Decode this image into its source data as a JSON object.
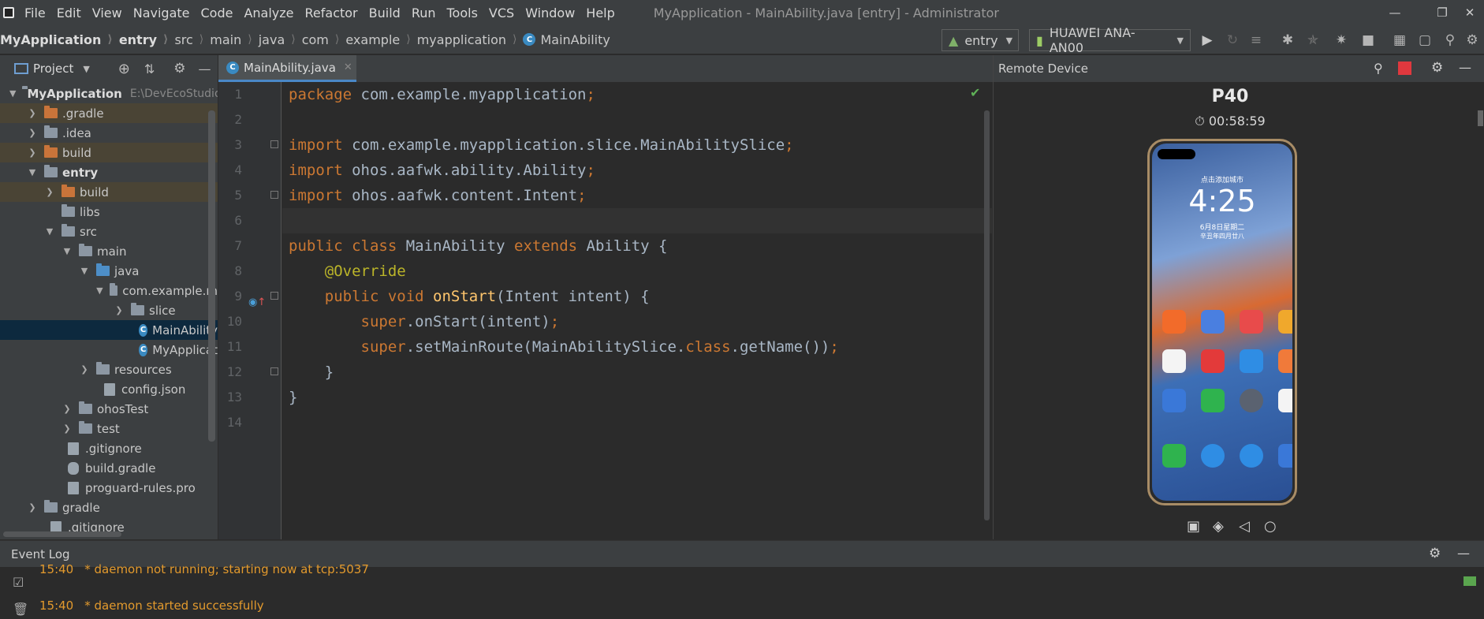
{
  "menubar": {
    "items": [
      "File",
      "Edit",
      "View",
      "Navigate",
      "Code",
      "Analyze",
      "Refactor",
      "Build",
      "Run",
      "Tools",
      "VCS",
      "Window",
      "Help"
    ],
    "title": "MyApplication - MainAbility.java [entry] - Administrator"
  },
  "breadcrumb": [
    "MyApplication",
    "entry",
    "src",
    "main",
    "java",
    "com",
    "example",
    "myapplication",
    "MainAbility"
  ],
  "toolbar": {
    "module": "entry",
    "device": "HUAWEI ANA-AN00"
  },
  "project": {
    "title": "Project",
    "tree": [
      {
        "label": "MyApplication",
        "extra": "E:\\DevEcoStudio"
      },
      {
        "label": ".gradle"
      },
      {
        "label": ".idea"
      },
      {
        "label": "build"
      },
      {
        "label": "entry"
      },
      {
        "label": "build"
      },
      {
        "label": "libs"
      },
      {
        "label": "src"
      },
      {
        "label": "main"
      },
      {
        "label": "java"
      },
      {
        "label": "com.example.m"
      },
      {
        "label": "slice"
      },
      {
        "label": "MainAbility"
      },
      {
        "label": "MyApplicat"
      },
      {
        "label": "resources"
      },
      {
        "label": "config.json"
      },
      {
        "label": "ohosTest"
      },
      {
        "label": "test"
      },
      {
        "label": ".gitignore"
      },
      {
        "label": "build.gradle"
      },
      {
        "label": "proguard-rules.pro"
      },
      {
        "label": "gradle"
      },
      {
        "label": ".gitignore"
      }
    ]
  },
  "editor": {
    "tab": "MainAbility.java",
    "line_numbers": [
      "1",
      "2",
      "3",
      "4",
      "5",
      "6",
      "7",
      "8",
      "9",
      "10",
      "11",
      "12",
      "13",
      "14"
    ],
    "code": {
      "l1a": "package",
      "l1b": " com.example.myapplication",
      "l1c": ";",
      "l3a": "import",
      "l3b": " com.example.myapplication.slice.MainAbilitySlice",
      "l3c": ";",
      "l4a": "import",
      "l4b": " ohos.aafwk.ability.Ability",
      "l4c": ";",
      "l5a": "import",
      "l5b": " ohos.aafwk.content.Intent",
      "l5c": ";",
      "l7a": "public class",
      "l7b": " MainAbility ",
      "l7c": "extends",
      "l7d": " Ability {",
      "l8": "    @Override",
      "l9a": "    public void",
      "l9b": " onStart",
      "l9c": "(Intent intent) {",
      "l10a": "        super",
      "l10b": ".onStart(intent)",
      "l10c": ";",
      "l11a": "        super",
      "l11b": ".setMainRoute(MainAbilitySlice.",
      "l11c": "class",
      "l11d": ".getName())",
      "l11e": ";",
      "l12": "    }",
      "l13": "}"
    }
  },
  "remote_device": {
    "title": "Remote Device",
    "model": "P40",
    "timer": "00:58:59",
    "lock_time": "4:25",
    "lock_date": "6月8日星期二",
    "lunar": "辛丑年四月廿八",
    "location": "点击添加城市"
  },
  "event_log": {
    "title": "Event Log",
    "lines": [
      {
        "time": "15:40",
        "text": "* daemon not running; starting now at tcp:5037"
      },
      {
        "time": "15:40",
        "text": "* daemon started successfully"
      }
    ]
  }
}
